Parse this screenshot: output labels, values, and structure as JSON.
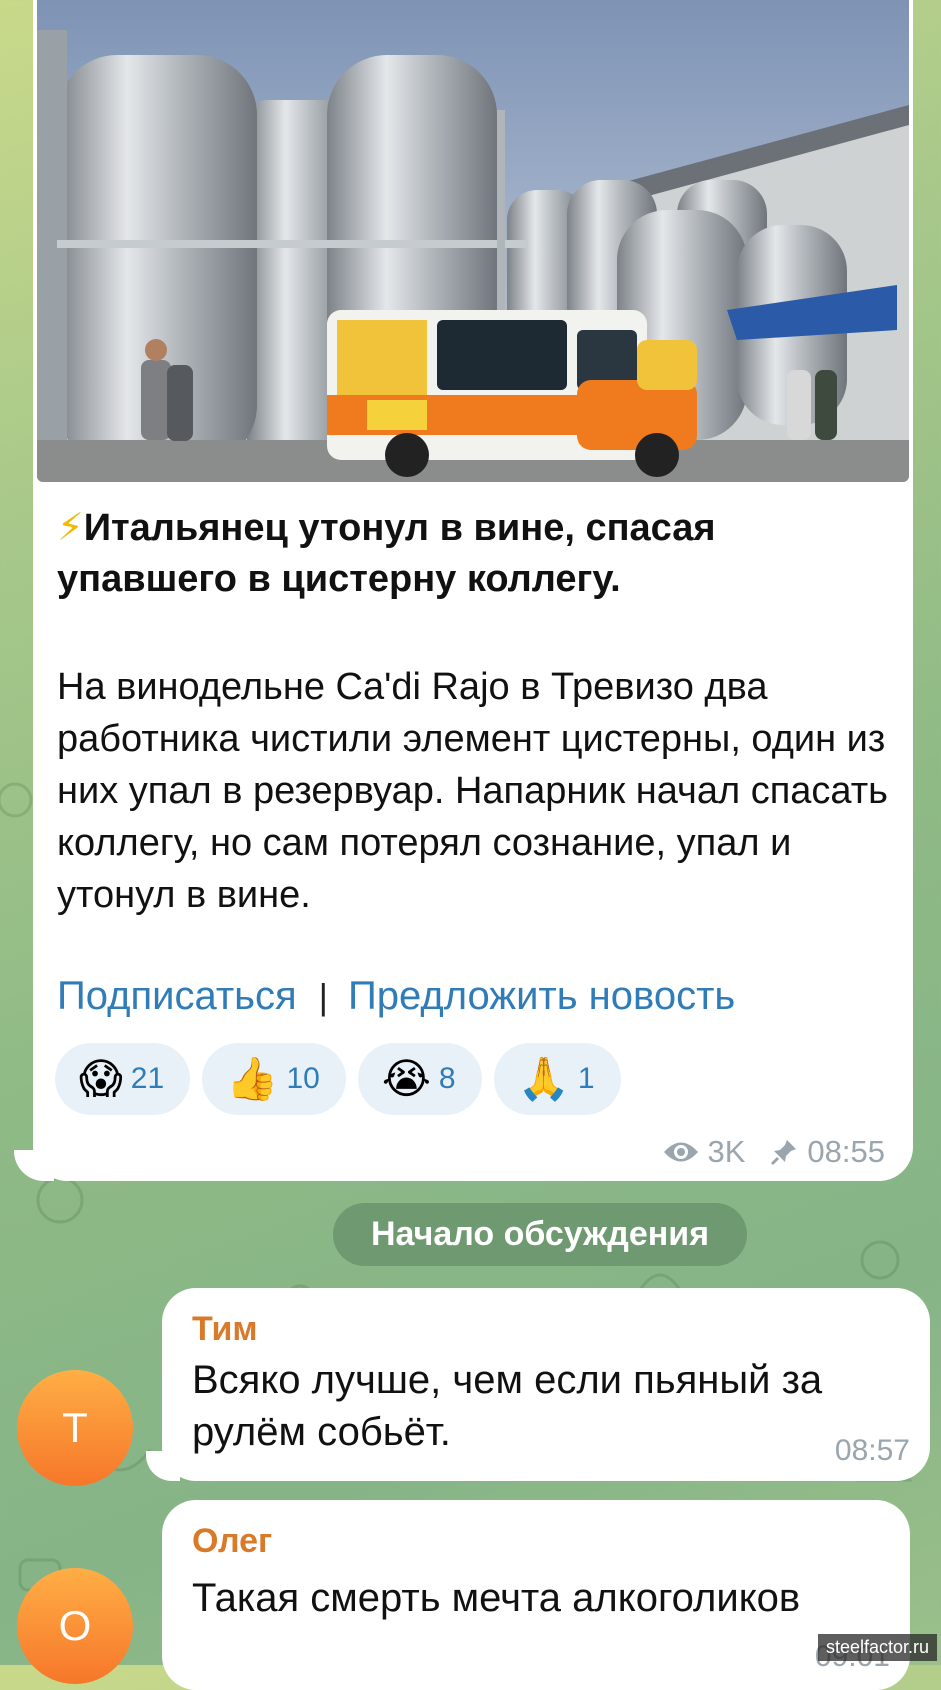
{
  "post": {
    "title_icon": "⚡",
    "title": "Итальянец утонул в вине, спасая упавшего в цистерну коллегу.",
    "body": "На винодельне Ca'di Rajo в Тревизо два работника чистили элемент цистерны, один из них упал в резервуар. Напарник начал спасать коллегу, но сам потерял сознание, упал и утонул в вине.",
    "link_subscribe": "Подписаться",
    "link_separator": "|",
    "link_suggest": "Предложить новость",
    "reactions": [
      {
        "emoji": "😱",
        "icon": "screaming-face-icon",
        "count": "21"
      },
      {
        "emoji": "👍",
        "icon": "thumbs-up-icon",
        "count": "10"
      },
      {
        "emoji": "😭",
        "icon": "crying-face-icon",
        "count": "8"
      },
      {
        "emoji": "🙏",
        "icon": "folded-hands-icon",
        "count": "1"
      }
    ],
    "views": "3K",
    "time": "08:55"
  },
  "discussion_label": "Начало обсуждения",
  "comments": [
    {
      "avatar_letter": "Т",
      "author": "Тим",
      "text": "Всяко лучше, чем если пьяный за рулём собьёт.",
      "time": "08:57"
    },
    {
      "avatar_letter": "О",
      "author": "Олег",
      "text": "Такая смерть мечта алкоголиков",
      "time": "09:01"
    }
  ],
  "watermark": "steelfactor.ru",
  "colors": {
    "link": "#2f7cb8",
    "author": "#d87a2a",
    "avatar": "#f6772a"
  }
}
